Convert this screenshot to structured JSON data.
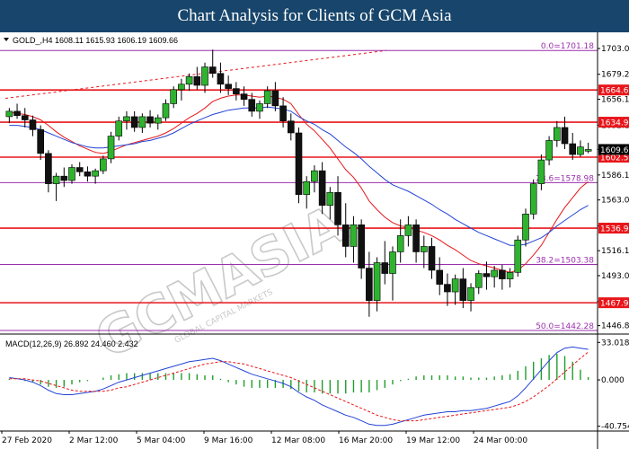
{
  "header": {
    "title": "Chart Analysis for Clients of GCM Asia"
  },
  "symbol_line": "GOLD_,H4  1608.11 1615.93 1606.19 1609.66",
  "macd_line": "MACD(12,26,9) 26.892 24.460 2.432",
  "watermark": "GCMASIA",
  "watermark_sub": "GLOBAL CAPITAL MARKETS",
  "chart_data": [
    {
      "type": "candlestick",
      "instrument": "GOLD_",
      "timeframe": "H4",
      "last_ohlc": {
        "open": 1608.11,
        "high": 1615.93,
        "low": 1606.19,
        "close": 1609.66
      },
      "ylim": [
        1439,
        1713
      ],
      "x_tick_labels": [
        "27 Feb 2020",
        "2 Mar 12:00",
        "5 Mar 04:00",
        "9 Mar 16:00",
        "12 Mar 08:00",
        "16 Mar 20:00",
        "19 Mar 12:00",
        "24 Mar 00:00"
      ],
      "y_tick_labels": [
        1703.0,
        1679.2,
        1656.1,
        1632.1,
        1609.66,
        1586.1,
        1563.0,
        1539.0,
        1516.1,
        1493.0,
        1469.1,
        1446.8
      ],
      "horizontal_levels": [
        {
          "value": 1664.69,
          "label": "1664.69",
          "color": "#e8161b"
        },
        {
          "value": 1634.91,
          "label": "1634.91",
          "color": "#e8161b"
        },
        {
          "value": 1602.56,
          "label": "1602.56",
          "color": "#e8161b"
        },
        {
          "value": 1536.93,
          "label": "1536.93",
          "color": "#e8161b"
        },
        {
          "value": 1467.95,
          "label": "1467.95",
          "color": "#e8161b"
        }
      ],
      "fibonacci_levels": [
        {
          "value": 1701.18,
          "label": "0.0=1701.18"
        },
        {
          "value": 1578.98,
          "label": "23.6=1578.98"
        },
        {
          "value": 1503.38,
          "label": "38.2=1503.38"
        },
        {
          "value": 1442.28,
          "label": "50.0=1442.28"
        }
      ],
      "current_price": {
        "value": 1609.66,
        "label": "1609.66"
      },
      "candles_ohlc": [
        [
          1640,
          1648,
          1634,
          1645
        ],
        [
          1645,
          1652,
          1638,
          1641
        ],
        [
          1641,
          1648,
          1630,
          1637
        ],
        [
          1637,
          1641,
          1622,
          1628
        ],
        [
          1628,
          1632,
          1600,
          1606
        ],
        [
          1606,
          1609,
          1570,
          1578
        ],
        [
          1578,
          1588,
          1562,
          1585
        ],
        [
          1585,
          1593,
          1575,
          1581
        ],
        [
          1581,
          1596,
          1578,
          1593
        ],
        [
          1593,
          1598,
          1585,
          1589
        ],
        [
          1589,
          1594,
          1580,
          1585
        ],
        [
          1585,
          1592,
          1578,
          1590
        ],
        [
          1590,
          1604,
          1587,
          1601
        ],
        [
          1601,
          1626,
          1597,
          1622
        ],
        [
          1622,
          1640,
          1618,
          1636
        ],
        [
          1636,
          1645,
          1628,
          1640
        ],
        [
          1640,
          1645,
          1626,
          1630
        ],
        [
          1630,
          1643,
          1625,
          1640
        ],
        [
          1640,
          1646,
          1630,
          1634
        ],
        [
          1634,
          1642,
          1628,
          1639
        ],
        [
          1639,
          1656,
          1636,
          1652
        ],
        [
          1652,
          1668,
          1648,
          1665
        ],
        [
          1665,
          1675,
          1655,
          1670
        ],
        [
          1670,
          1680,
          1664,
          1677
        ],
        [
          1677,
          1686,
          1665,
          1669
        ],
        [
          1669,
          1690,
          1662,
          1686
        ],
        [
          1686,
          1702,
          1676,
          1680
        ],
        [
          1680,
          1690,
          1662,
          1670
        ],
        [
          1670,
          1678,
          1660,
          1666
        ],
        [
          1666,
          1672,
          1655,
          1661
        ],
        [
          1661,
          1668,
          1650,
          1656
        ],
        [
          1656,
          1662,
          1640,
          1645
        ],
        [
          1645,
          1655,
          1638,
          1652
        ],
        [
          1652,
          1668,
          1648,
          1664
        ],
        [
          1664,
          1672,
          1645,
          1650
        ],
        [
          1650,
          1658,
          1630,
          1636
        ],
        [
          1636,
          1643,
          1618,
          1625
        ],
        [
          1625,
          1630,
          1560,
          1568
        ],
        [
          1568,
          1585,
          1555,
          1580
        ],
        [
          1580,
          1595,
          1570,
          1590
        ],
        [
          1590,
          1598,
          1550,
          1558
        ],
        [
          1558,
          1575,
          1545,
          1570
        ],
        [
          1570,
          1585,
          1530,
          1540
        ],
        [
          1540,
          1560,
          1510,
          1520
        ],
        [
          1520,
          1548,
          1505,
          1540
        ],
        [
          1540,
          1545,
          1490,
          1500
        ],
        [
          1500,
          1515,
          1455,
          1470
        ],
        [
          1470,
          1510,
          1460,
          1505
        ],
        [
          1505,
          1525,
          1485,
          1495
        ],
        [
          1495,
          1520,
          1470,
          1515
        ],
        [
          1515,
          1545,
          1505,
          1530
        ],
        [
          1530,
          1548,
          1520,
          1540
        ],
        [
          1540,
          1545,
          1505,
          1515
        ],
        [
          1515,
          1530,
          1500,
          1520
        ],
        [
          1520,
          1528,
          1490,
          1498
        ],
        [
          1498,
          1510,
          1475,
          1485
        ],
        [
          1485,
          1495,
          1465,
          1478
        ],
        [
          1478,
          1494,
          1466,
          1490
        ],
        [
          1490,
          1500,
          1463,
          1470
        ],
        [
          1470,
          1486,
          1460,
          1482
        ],
        [
          1482,
          1498,
          1476,
          1495
        ],
        [
          1495,
          1506,
          1480,
          1492
        ],
        [
          1492,
          1502,
          1482,
          1498
        ],
        [
          1498,
          1503,
          1480,
          1490
        ],
        [
          1490,
          1500,
          1482,
          1496
        ],
        [
          1496,
          1530,
          1492,
          1526
        ],
        [
          1526,
          1555,
          1520,
          1550
        ],
        [
          1550,
          1582,
          1545,
          1578
        ],
        [
          1578,
          1605,
          1572,
          1600
        ],
        [
          1600,
          1622,
          1595,
          1618
        ],
        [
          1618,
          1636,
          1612,
          1630
        ],
        [
          1630,
          1640,
          1610,
          1615
        ],
        [
          1615,
          1625,
          1600,
          1605
        ],
        [
          1605,
          1618,
          1603,
          1612
        ],
        [
          1608.11,
          1615.93,
          1606.19,
          1609.66
        ]
      ],
      "series": [
        {
          "name": "",
          "color": "#e8161b",
          "values": [
            1644,
            1643,
            1642,
            1640,
            1637,
            1632,
            1626,
            1621,
            1617,
            1613,
            1610,
            1607,
            1606,
            1608,
            1611,
            1614,
            1616,
            1618,
            1620,
            1622,
            1625,
            1629,
            1634,
            1639,
            1643,
            1648,
            1654,
            1657,
            1659,
            1660,
            1660,
            1659,
            1658,
            1659,
            1658,
            1656,
            1652,
            1642,
            1633,
            1627,
            1619,
            1611,
            1601,
            1591,
            1584,
            1574,
            1562,
            1554,
            1547,
            1542,
            1539,
            1538,
            1535,
            1533,
            1530,
            1526,
            1521,
            1517,
            1512,
            1507,
            1504,
            1502,
            1500,
            1498,
            1496,
            1498,
            1504,
            1512,
            1521,
            1533,
            1545,
            1556,
            1565,
            1574,
            1580
          ]
        },
        {
          "name": "",
          "color": "#2243d6",
          "values": [
            1632,
            1632,
            1631,
            1630,
            1628,
            1625,
            1622,
            1619,
            1616,
            1614,
            1612,
            1611,
            1611,
            1612,
            1613,
            1614,
            1615,
            1617,
            1618,
            1620,
            1622,
            1625,
            1629,
            1633,
            1636,
            1639,
            1642,
            1644,
            1646,
            1647,
            1648,
            1648,
            1648,
            1649,
            1648,
            1647,
            1645,
            1640,
            1636,
            1633,
            1628,
            1624,
            1618,
            1612,
            1607,
            1601,
            1594,
            1588,
            1582,
            1577,
            1574,
            1571,
            1567,
            1563,
            1559,
            1554,
            1550,
            1545,
            1541,
            1537,
            1533,
            1530,
            1527,
            1524,
            1521,
            1521,
            1522,
            1525,
            1528,
            1533,
            1539,
            1544,
            1549,
            1554,
            1558
          ]
        }
      ]
    },
    {
      "type": "macd",
      "name": "MACD(12,26,9)",
      "params": [
        12,
        26,
        9
      ],
      "last": {
        "macd": 26.892,
        "signal": 24.46,
        "histogram": 2.432
      },
      "ylim": [
        -45,
        38
      ],
      "y_tick_labels": [
        33.018,
        0.0,
        -40.754
      ],
      "series": [
        {
          "name": "",
          "color": "#2243d6",
          "values": [
            2,
            1,
            0,
            -2,
            -5,
            -9,
            -12,
            -13,
            -13,
            -12,
            -11,
            -10,
            -8,
            -5,
            -2,
            0,
            2,
            4,
            6,
            8,
            10,
            12,
            14,
            16,
            17,
            18,
            19,
            17,
            14,
            11,
            8,
            5,
            3,
            1,
            -1,
            -3,
            -6,
            -11,
            -15,
            -18,
            -22,
            -25,
            -28,
            -31,
            -33,
            -36,
            -39,
            -40,
            -40,
            -39,
            -37,
            -35,
            -33,
            -31,
            -30,
            -29,
            -28,
            -28,
            -27,
            -27,
            -26,
            -25,
            -23,
            -21,
            -19,
            -14,
            -7,
            1,
            9,
            17,
            24,
            28,
            29,
            28,
            26.9
          ]
        },
        {
          "name": "",
          "color": "#e8161b",
          "values": [
            1,
            1,
            1,
            0,
            -1,
            -3,
            -5,
            -7,
            -9,
            -10,
            -10,
            -10,
            -10,
            -9,
            -7,
            -6,
            -4,
            -2,
            0,
            2,
            4,
            6,
            8,
            10,
            12,
            14,
            15,
            16,
            16,
            15,
            14,
            12,
            10,
            8,
            6,
            4,
            2,
            -1,
            -4,
            -7,
            -10,
            -13,
            -16,
            -19,
            -22,
            -25,
            -28,
            -31,
            -33,
            -35,
            -36,
            -36,
            -36,
            -35,
            -34,
            -33,
            -32,
            -31,
            -30,
            -29,
            -28,
            -27,
            -26,
            -25,
            -24,
            -22,
            -19,
            -15,
            -10,
            -5,
            1,
            7,
            13,
            19,
            24.46
          ]
        },
        {
          "name": "",
          "color": "#1f9e2c",
          "values": [
            1,
            0,
            -1,
            -2,
            -4,
            -6,
            -7,
            -6,
            -4,
            -2,
            -1,
            0,
            2,
            4,
            5,
            6,
            6,
            6,
            6,
            6,
            6,
            6,
            6,
            6,
            5,
            4,
            4,
            1,
            -2,
            -4,
            -6,
            -7,
            -7,
            -7,
            -7,
            -7,
            -8,
            -10,
            -11,
            -11,
            -12,
            -12,
            -12,
            -12,
            -11,
            -11,
            -11,
            -9,
            -7,
            -4,
            -1,
            1,
            3,
            4,
            4,
            4,
            4,
            3,
            3,
            2,
            2,
            2,
            3,
            4,
            5,
            8,
            12,
            16,
            19,
            22,
            23,
            21,
            16,
            9,
            2.432
          ]
        }
      ]
    }
  ]
}
